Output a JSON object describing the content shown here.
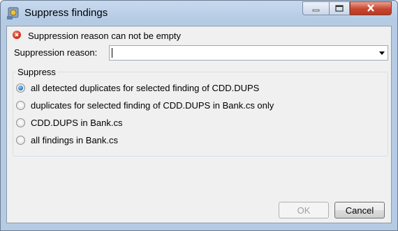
{
  "window": {
    "title": "Suppress findings"
  },
  "error": {
    "message": "Suppression reason can not be empty"
  },
  "reason": {
    "label": "Suppression reason:",
    "value": ""
  },
  "suppress": {
    "label": "Suppress",
    "options": [
      {
        "label": "all detected duplicates for selected finding of CDD.DUPS",
        "selected": true
      },
      {
        "label": "duplicates for selected finding of CDD.DUPS in Bank.cs only",
        "selected": false
      },
      {
        "label": "CDD.DUPS in Bank.cs",
        "selected": false
      },
      {
        "label": "all findings in Bank.cs",
        "selected": false
      }
    ]
  },
  "buttons": {
    "ok": "OK",
    "cancel": "Cancel"
  }
}
